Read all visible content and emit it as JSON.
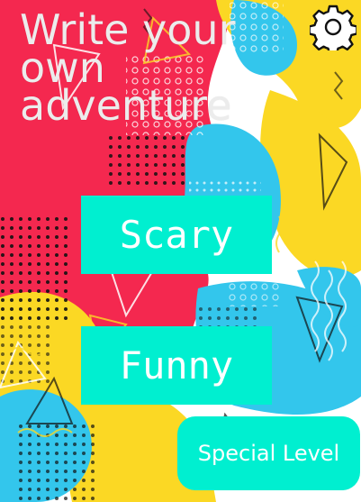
{
  "title": "Write your own adventure",
  "icons": {
    "settings": "gear-icon"
  },
  "buttons": {
    "scary": "Scary",
    "funny": "Funny",
    "special": "Special Level"
  },
  "colors": {
    "button": "#00efd0",
    "text": "#ffffff",
    "title": "#ececec",
    "bg_red": "#f4284f",
    "bg_yellow": "#fbd824",
    "bg_cyan": "#33c6ec"
  }
}
